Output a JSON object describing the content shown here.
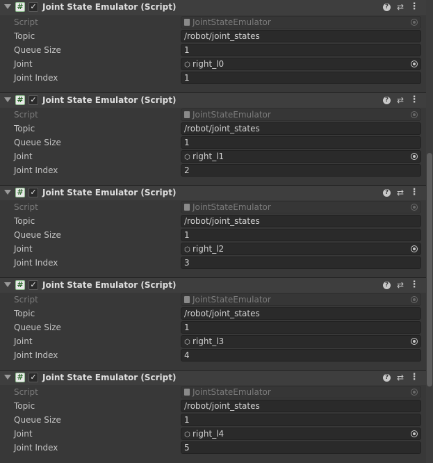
{
  "components": [
    {
      "title": "Joint State Emulator (Script)",
      "enabled": true,
      "props": {
        "script": {
          "label": "Script",
          "value": "JointStateEmulator"
        },
        "topic": {
          "label": "Topic",
          "value": "/robot/joint_states"
        },
        "queue_size": {
          "label": "Queue Size",
          "value": "1"
        },
        "joint": {
          "label": "Joint",
          "value": "right_l0"
        },
        "joint_index": {
          "label": "Joint Index",
          "value": "1"
        }
      }
    },
    {
      "title": "Joint State Emulator (Script)",
      "enabled": true,
      "props": {
        "script": {
          "label": "Script",
          "value": "JointStateEmulator"
        },
        "topic": {
          "label": "Topic",
          "value": "/robot/joint_states"
        },
        "queue_size": {
          "label": "Queue Size",
          "value": "1"
        },
        "joint": {
          "label": "Joint",
          "value": "right_l1"
        },
        "joint_index": {
          "label": "Joint Index",
          "value": "2"
        }
      }
    },
    {
      "title": "Joint State Emulator (Script)",
      "enabled": true,
      "props": {
        "script": {
          "label": "Script",
          "value": "JointStateEmulator"
        },
        "topic": {
          "label": "Topic",
          "value": "/robot/joint_states"
        },
        "queue_size": {
          "label": "Queue Size",
          "value": "1"
        },
        "joint": {
          "label": "Joint",
          "value": "right_l2"
        },
        "joint_index": {
          "label": "Joint Index",
          "value": "3"
        }
      }
    },
    {
      "title": "Joint State Emulator (Script)",
      "enabled": true,
      "props": {
        "script": {
          "label": "Script",
          "value": "JointStateEmulator"
        },
        "topic": {
          "label": "Topic",
          "value": "/robot/joint_states"
        },
        "queue_size": {
          "label": "Queue Size",
          "value": "1"
        },
        "joint": {
          "label": "Joint",
          "value": "right_l3"
        },
        "joint_index": {
          "label": "Joint Index",
          "value": "4"
        }
      }
    },
    {
      "title": "Joint State Emulator (Script)",
      "enabled": true,
      "props": {
        "script": {
          "label": "Script",
          "value": "JointStateEmulator"
        },
        "topic": {
          "label": "Topic",
          "value": "/robot/joint_states"
        },
        "queue_size": {
          "label": "Queue Size",
          "value": "1"
        },
        "joint": {
          "label": "Joint",
          "value": "right_l4"
        },
        "joint_index": {
          "label": "Joint Index",
          "value": "5"
        }
      }
    }
  ],
  "icons": {
    "foldout": "triangle-down-icon",
    "script": "csharp-script-icon",
    "help": "help-icon",
    "presets": "presets-sliders-icon",
    "menu": "kebab-menu-icon",
    "object_picker": "object-picker-icon",
    "gameobject": "gameobject-cube-icon"
  },
  "colors": {
    "background": "#383838",
    "header": "#3e3e3e",
    "field": "#2a2a2a",
    "text": "#c4c4c4",
    "disabled_text": "#7b7b7b"
  }
}
